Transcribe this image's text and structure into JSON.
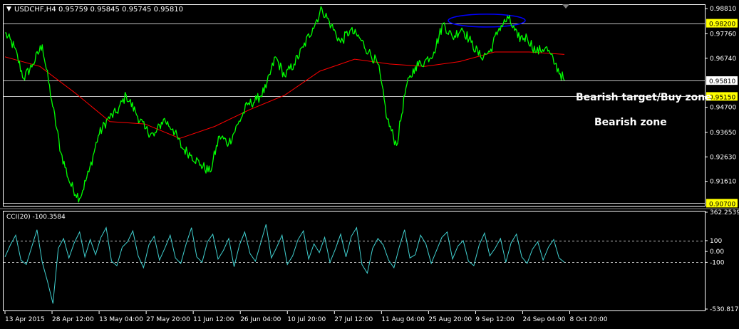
{
  "window": {
    "menu_glyph": "▼",
    "symbol_tf": "USDCHF,H4",
    "ohlc": "0.95759 0.95845 0.95745 0.95810"
  },
  "colors": {
    "background": "#000000",
    "price": "#00ff00",
    "ma": "#ff0000",
    "hline": "#c0c0c0",
    "hline_label_bg": "#ffff00",
    "current_label_bg": "#ffffff",
    "ellipse": "#0000ff",
    "cci": "#40d0d0",
    "text": "#ffffff"
  },
  "annotations": {
    "buy_zone": "Bearish target/Buy zone",
    "bearish_zone": "Bearish zone"
  },
  "chart_data": [
    {
      "type": "line",
      "name": "price",
      "symbol": "USDCHF",
      "timeframe": "H4",
      "ylim": [
        0.9062,
        0.9896
      ],
      "y_ticks": [
        "0.98810",
        "0.97760",
        "0.96740",
        "0.94700",
        "0.93650",
        "0.92630",
        "0.91610"
      ],
      "x_ticks": [
        "13 Apr 2015",
        "28 Apr 12:00",
        "13 May 04:00",
        "27 May 20:00",
        "11 Jun 12:00",
        "26 Jun 04:00",
        "10 Jul 20:00",
        "27 Jul 12:00",
        "11 Aug 04:00",
        "25 Aug 20:00",
        "9 Sep 12:00",
        "24 Sep 04:00",
        "8 Oct 20:00"
      ],
      "series": [
        {
          "name": "close",
          "x": [
            "13 Apr",
            "16 Apr",
            "20 Apr",
            "23 Apr",
            "28 Apr",
            "30 Apr",
            "4 May",
            "7 May",
            "11 May",
            "13 May",
            "15 May",
            "19 May",
            "22 May",
            "27 May",
            "29 May",
            "2 Jun",
            "5 Jun",
            "8 Jun",
            "11 Jun",
            "15 Jun",
            "18 Jun",
            "22 Jun",
            "26 Jun",
            "29 Jun",
            "2 Jul",
            "6 Jul",
            "10 Jul",
            "13 Jul",
            "16 Jul",
            "20 Jul",
            "23 Jul",
            "27 Jul",
            "29 Jul",
            "31 Jul",
            "4 Aug",
            "6 Aug",
            "10 Aug",
            "12 Aug",
            "14 Aug",
            "18 Aug",
            "20 Aug",
            "24 Aug",
            "25 Aug",
            "27 Aug",
            "31 Aug",
            "3 Sep",
            "7 Sep",
            "9 Sep",
            "11 Sep",
            "14 Sep",
            "16 Sep",
            "18 Sep",
            "21 Sep",
            "23 Sep",
            "24 Sep",
            "28 Sep",
            "30 Sep",
            "2 Oct",
            "6 Oct",
            "8 Oct",
            "12 Oct"
          ],
          "values": [
            0.978,
            0.972,
            0.959,
            0.965,
            0.973,
            0.95,
            0.928,
            0.915,
            0.909,
            0.92,
            0.935,
            0.942,
            0.945,
            0.952,
            0.945,
            0.938,
            0.935,
            0.942,
            0.938,
            0.93,
            0.927,
            0.923,
            0.92,
            0.935,
            0.932,
            0.94,
            0.948,
            0.95,
            0.955,
            0.968,
            0.96,
            0.965,
            0.972,
            0.98,
            0.988,
            0.981,
            0.974,
            0.979,
            0.976,
            0.97,
            0.965,
            0.942,
            0.931,
            0.955,
            0.964,
            0.966,
            0.97,
            0.982,
            0.976,
            0.98,
            0.974,
            0.968,
            0.97,
            0.98,
            0.984,
            0.976,
            0.976,
            0.97,
            0.972,
            0.965,
            0.9581
          ]
        },
        {
          "name": "moving average",
          "x": [
            "13 Apr",
            "30 Apr",
            "15 May",
            "2 Jun",
            "15 Jun",
            "26 Jun",
            "10 Jul",
            "23 Jul",
            "4 Aug",
            "14 Aug",
            "20 Aug",
            "27 Aug",
            "7 Sep",
            "18 Sep",
            "28 Sep",
            "8 Oct",
            "12 Oct"
          ],
          "values": [
            0.968,
            0.964,
            0.953,
            0.941,
            0.94,
            0.934,
            0.939,
            0.946,
            0.952,
            0.962,
            0.967,
            0.965,
            0.964,
            0.966,
            0.97,
            0.97,
            0.969
          ]
        }
      ],
      "horizontal_lines": [
        {
          "value": 0.982,
          "label": "0.98200"
        },
        {
          "value": 0.9581,
          "label": "0.95810"
        },
        {
          "value": 0.9515,
          "label": "0.95150"
        },
        {
          "value": 0.907,
          "label": "0.90700"
        }
      ],
      "current_price_label": "0.95810"
    },
    {
      "type": "line",
      "name": "CCI(20)",
      "header": "CCI(20) -100.3584",
      "ylim": [
        -530.8174,
        362.2539
      ],
      "y_ticks": [
        "362.2539",
        "100",
        "0.00",
        "-100",
        "-530.8174"
      ],
      "levels": [
        100,
        -100
      ],
      "series": [
        {
          "name": "CCI(20)",
          "values": [
            -50,
            60,
            150,
            -80,
            -120,
            40,
            200,
            -100,
            -280,
            -480,
            30,
            120,
            -60,
            80,
            180,
            -50,
            110,
            -30,
            130,
            220,
            -90,
            -130,
            40,
            90,
            190,
            -40,
            -150,
            60,
            140,
            -80,
            30,
            150,
            -60,
            -110,
            70,
            220,
            -50,
            -100,
            90,
            160,
            -70,
            10,
            120,
            -140,
            60,
            180,
            -20,
            -90,
            80,
            250,
            -60,
            40,
            150,
            -120,
            -40,
            110,
            190,
            -70,
            70,
            -10,
            130,
            -100,
            20,
            160,
            -50,
            140,
            220,
            -120,
            -200,
            30,
            120,
            60,
            -80,
            -150,
            40,
            200,
            -60,
            -30,
            150,
            70,
            -110,
            10,
            130,
            180,
            -70,
            50,
            100,
            -90,
            -130,
            60,
            170,
            -40,
            30,
            120,
            -100,
            80,
            160,
            -50,
            -110,
            20,
            90,
            -80,
            40,
            110,
            -60,
            -100
          ]
        }
      ]
    }
  ]
}
